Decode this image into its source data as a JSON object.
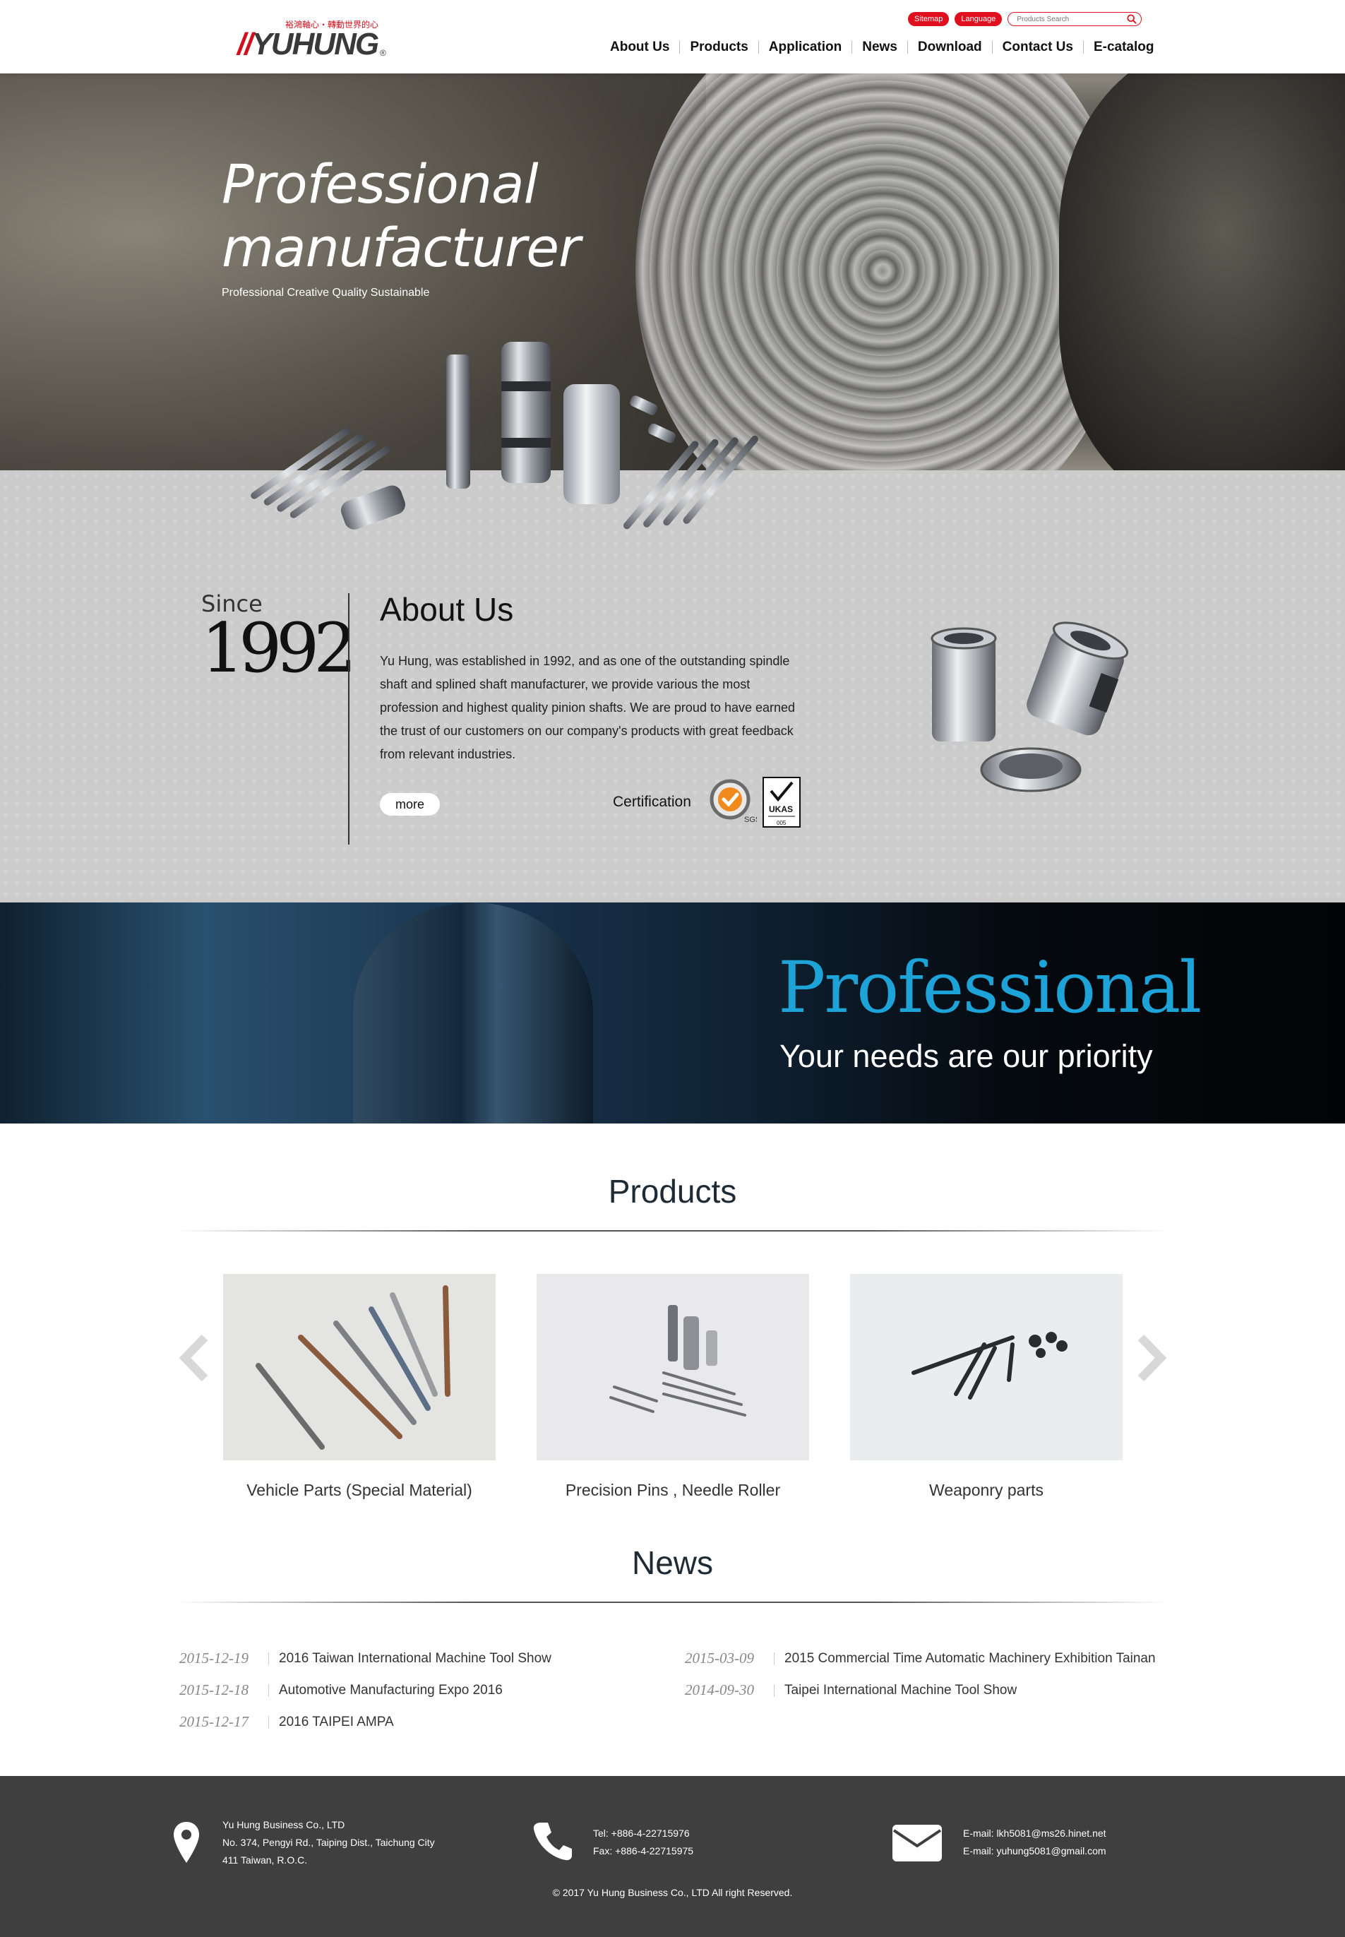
{
  "header": {
    "logo_tagline": "裕鴻軸心・轉動世界的心",
    "logo_text": "YUHUNG",
    "util": {
      "sitemap": "Sitemap",
      "language": "Language",
      "search_placeholder": "Products Search"
    },
    "nav": [
      "About Us",
      "Products",
      "Application",
      "News",
      "Download",
      "Contact Us",
      "E-catalog"
    ]
  },
  "hero": {
    "title_line1": "Professional",
    "title_line2": "manufacturer",
    "subtitle": "Professional Creative Quality Sustainable"
  },
  "about": {
    "since_word": "Since",
    "since_year": "1992",
    "title": "About Us",
    "text": "Yu Hung, was established in 1992, and as one of the outstanding spindle shaft and splined shaft manufacturer, we provide various the most profession and highest quality pinion shafts. We are proud to have earned the trust of our customers on our company's products with great feedback from relevant industries.",
    "more": "more",
    "certification": "Certification",
    "ukas_label": "UKAS"
  },
  "banner": {
    "title": "Professional",
    "subtitle": "Your needs are our priority"
  },
  "products": {
    "title": "Products",
    "items": [
      {
        "caption": "Vehicle Parts (Special Material)"
      },
      {
        "caption": "Precision Pins , Needle Roller"
      },
      {
        "caption": "Weaponry parts"
      }
    ]
  },
  "news": {
    "title": "News",
    "left": [
      {
        "date": "2015-12-19",
        "title": "2016 Taiwan International Machine Tool Show"
      },
      {
        "date": "2015-12-18",
        "title": "Automotive Manufacturing Expo 2016"
      },
      {
        "date": "2015-12-17",
        "title": "2016 TAIPEI AMPA"
      }
    ],
    "right": [
      {
        "date": "2015-03-09",
        "title": "2015 Commercial Time Automatic Machinery Exhibition Tainan"
      },
      {
        "date": "2014-09-30",
        "title": "Taipei International Machine Tool Show"
      }
    ]
  },
  "footer": {
    "company": "Yu Hung Business Co., LTD",
    "address1": "No. 374, Pengyi Rd., Taiping Dist., Taichung City",
    "address2": "411 Taiwan, R.O.C.",
    "tel": "Tel: +886-4-22715976",
    "fax": "Fax: +886-4-22715975",
    "email1": "E-mail: lkh5081@ms26.hinet.net",
    "email2": "E-mail: yuhung5081@gmail.com",
    "copyright": "© 2017 Yu Hung Business Co., LTD All right Reserved."
  },
  "colors": {
    "brand_red": "#e0101f",
    "banner_blue": "#1ea3d8",
    "footer_bg": "#3f3f3f"
  }
}
